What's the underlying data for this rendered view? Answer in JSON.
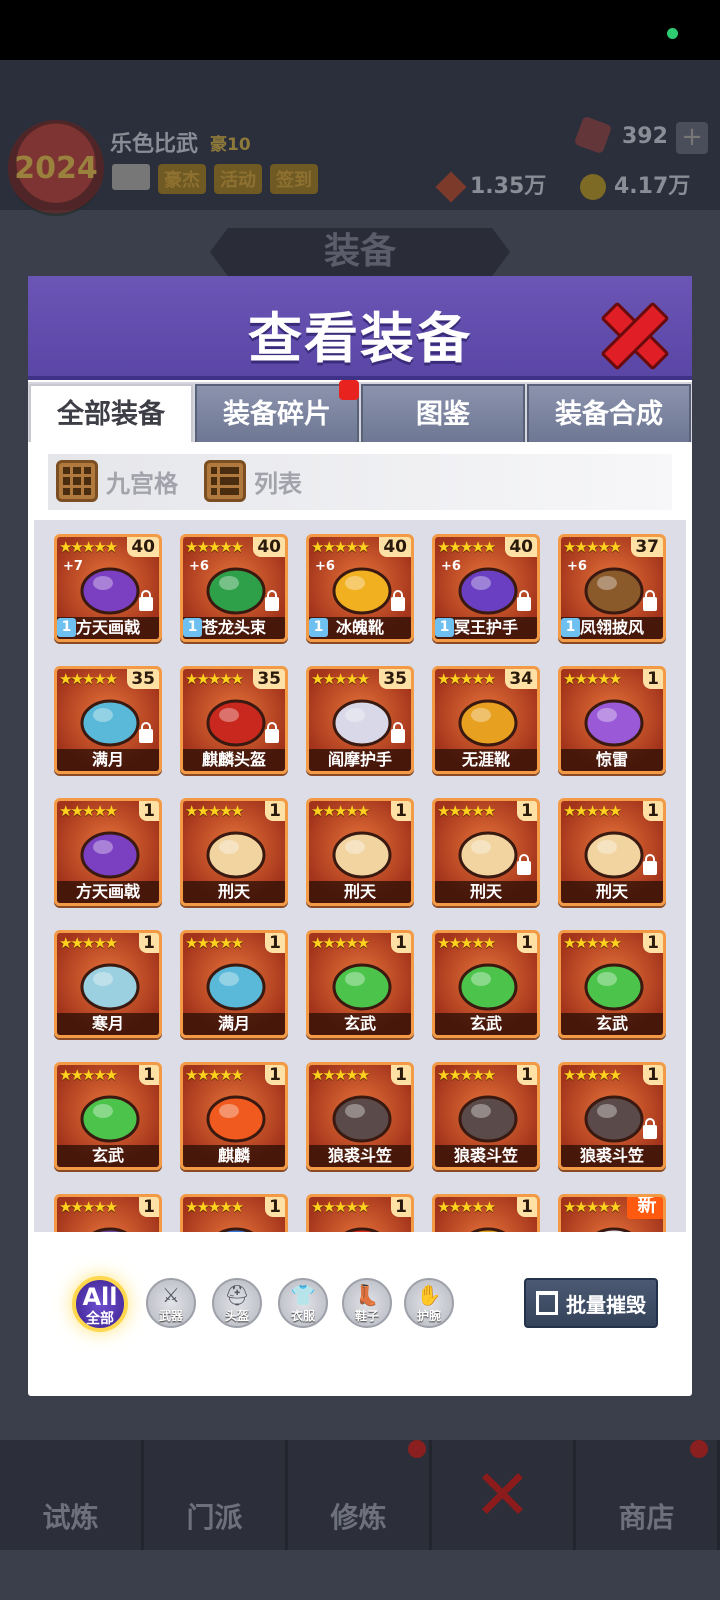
{
  "background": {
    "player_name": "乐色比武",
    "vip": "豪10",
    "buttons": [
      "豪杰",
      "活动",
      "签到"
    ],
    "gems": "392",
    "plus": "+",
    "currency1": "1.35万",
    "currency2": "4.17万",
    "section_title": "装备",
    "logo_text": "2024",
    "bottom_nav": [
      "试炼",
      "门派",
      "修炼",
      "",
      "商店"
    ]
  },
  "modal": {
    "title": "查看装备",
    "tabs": [
      {
        "label": "全部装备",
        "active": true
      },
      {
        "label": "装备碎片",
        "badge": true
      },
      {
        "label": "图鉴"
      },
      {
        "label": "装备合成"
      }
    ],
    "view_options": {
      "grid": "九宫格",
      "list": "列表"
    }
  },
  "items": [
    {
      "name": "方天画戟",
      "level": "40",
      "stars": 5,
      "plus": "+7",
      "rank": "1",
      "locked": true,
      "icon": "halberd-icon",
      "color": "#7b3fc2"
    },
    {
      "name": "苍龙头束",
      "level": "40",
      "stars": 5,
      "plus": "+6",
      "rank": "1",
      "locked": true,
      "icon": "dragon-headband-icon",
      "color": "#2ea04a"
    },
    {
      "name": "冰魄靴",
      "level": "40",
      "stars": 5,
      "plus": "+6",
      "rank": "1",
      "locked": true,
      "icon": "boots-icon",
      "color": "#f0b020"
    },
    {
      "name": "冥王护手",
      "level": "40",
      "stars": 5,
      "plus": "+6",
      "rank": "1",
      "locked": true,
      "icon": "gauntlet-icon",
      "color": "#6a3fc2"
    },
    {
      "name": "凤翎披风",
      "level": "37",
      "stars": 5,
      "plus": "+6",
      "rank": "1",
      "locked": true,
      "icon": "cloak-icon",
      "color": "#8b5a2b"
    },
    {
      "name": "满月",
      "level": "35",
      "stars": 5,
      "locked": true,
      "icon": "moon-blade-icon",
      "color": "#5ab8d8"
    },
    {
      "name": "麒麟头盔",
      "level": "35",
      "stars": 5,
      "locked": true,
      "icon": "helmet-icon",
      "color": "#c8281e"
    },
    {
      "name": "阎摩护手",
      "level": "35",
      "stars": 5,
      "locked": true,
      "icon": "gauntlet-icon",
      "color": "#d8d8e8"
    },
    {
      "name": "无涯靴",
      "level": "34",
      "stars": 5,
      "icon": "boots-icon",
      "color": "#e8a020"
    },
    {
      "name": "惊雷",
      "level": "1",
      "stars": 5,
      "icon": "lightning-spear-icon",
      "color": "#9a5ad8"
    },
    {
      "name": "方天画戟",
      "level": "1",
      "stars": 5,
      "icon": "halberd-icon",
      "color": "#7b3fc2"
    },
    {
      "name": "刑天",
      "level": "1",
      "stars": 5,
      "icon": "axe-icon",
      "color": "#f2d4a0"
    },
    {
      "name": "刑天",
      "level": "1",
      "stars": 5,
      "icon": "axe-icon",
      "color": "#f2d4a0"
    },
    {
      "name": "刑天",
      "level": "1",
      "stars": 5,
      "locked": true,
      "icon": "axe-icon",
      "color": "#f2d4a0"
    },
    {
      "name": "刑天",
      "level": "1",
      "stars": 5,
      "locked": true,
      "icon": "axe-icon",
      "color": "#f2d4a0"
    },
    {
      "name": "寒月",
      "level": "1",
      "stars": 5,
      "icon": "sword-icon",
      "color": "#9ad0e0"
    },
    {
      "name": "满月",
      "level": "1",
      "stars": 5,
      "icon": "moon-blade-icon",
      "color": "#5ab8d8"
    },
    {
      "name": "玄武",
      "level": "1",
      "stars": 5,
      "icon": "jade-charm-icon",
      "color": "#4cc44c"
    },
    {
      "name": "玄武",
      "level": "1",
      "stars": 5,
      "icon": "jade-charm-icon",
      "color": "#4cc44c"
    },
    {
      "name": "玄武",
      "level": "1",
      "stars": 5,
      "icon": "jade-charm-icon",
      "color": "#4cc44c"
    },
    {
      "name": "玄武",
      "level": "1",
      "stars": 5,
      "icon": "jade-charm-icon",
      "color": "#4cc44c"
    },
    {
      "name": "麒麟",
      "level": "1",
      "stars": 5,
      "icon": "phoenix-charm-icon",
      "color": "#f05a1e"
    },
    {
      "name": "狼裘斗笠",
      "level": "1",
      "stars": 5,
      "icon": "straw-hat-icon",
      "color": "#5a4a4a"
    },
    {
      "name": "狼裘斗笠",
      "level": "1",
      "stars": 5,
      "icon": "straw-hat-icon",
      "color": "#5a4a4a"
    },
    {
      "name": "狼裘斗笠",
      "level": "1",
      "stars": 5,
      "locked": true,
      "icon": "straw-hat-icon",
      "color": "#5a4a4a"
    },
    {
      "name": "",
      "level": "1",
      "stars": 5,
      "icon": "hat-icon",
      "color": "#6a4aa0"
    },
    {
      "name": "",
      "level": "1",
      "stars": 5,
      "icon": "crown-icon",
      "color": "#3a78d8"
    },
    {
      "name": "",
      "level": "1",
      "stars": 5,
      "icon": "banner-icon",
      "color": "#d83020"
    },
    {
      "name": "",
      "level": "1",
      "stars": 5,
      "icon": "helmet-icon",
      "color": "#e0a020"
    },
    {
      "name": "",
      "stars": 5,
      "new": "新",
      "icon": "robe-icon",
      "color": "#ecebf2"
    }
  ],
  "filters": {
    "all_big": "All",
    "all_small": "全部",
    "categories": [
      {
        "label": "武器",
        "icon": "weapon-icon",
        "glyph": "⚔"
      },
      {
        "label": "头盔",
        "icon": "helmet-icon",
        "glyph": "⛑"
      },
      {
        "label": "衣服",
        "icon": "clothes-icon",
        "glyph": "👕"
      },
      {
        "label": "鞋子",
        "icon": "shoe-icon",
        "glyph": "👢"
      },
      {
        "label": "护腕",
        "icon": "bracer-icon",
        "glyph": "✋"
      }
    ],
    "bulk_destroy": "批量摧毁"
  }
}
